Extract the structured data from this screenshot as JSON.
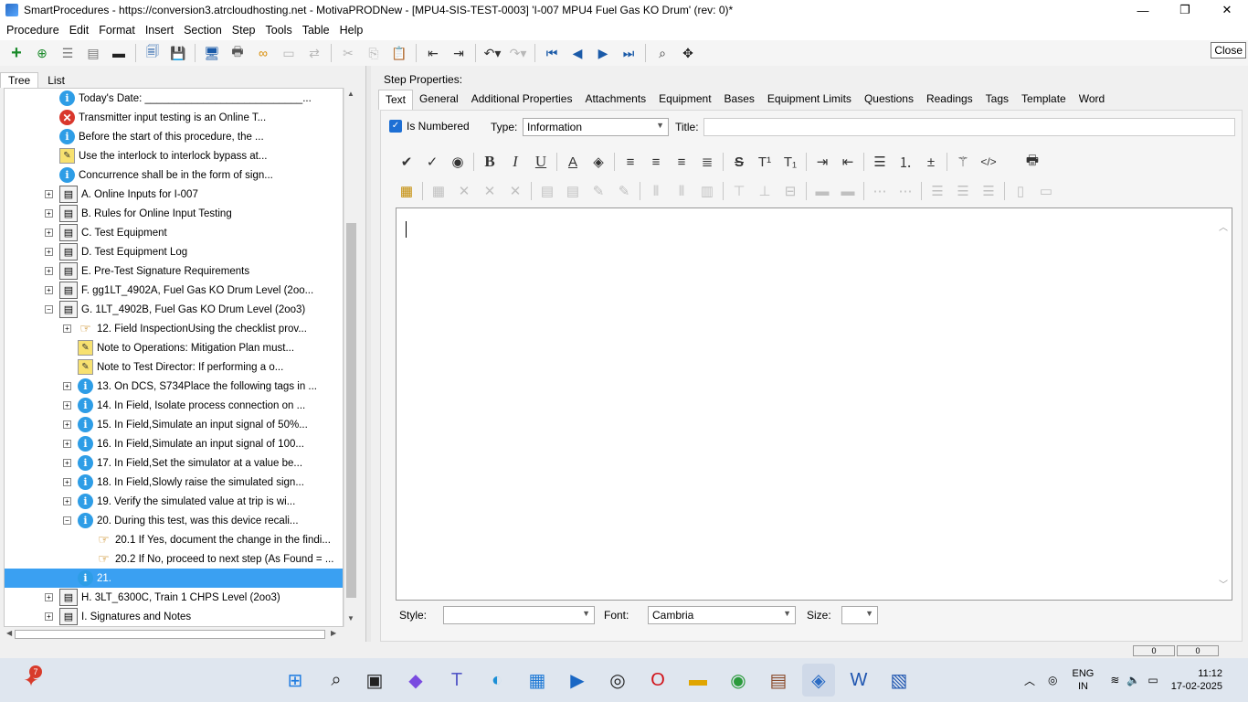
{
  "window": {
    "title": "SmartProcedures - https://conversion3.atrcloudhosting.net - MotivaPRODNew - [MPU4-SIS-TEST-0003] 'I-007 MPU4 Fuel Gas KO Drum' (rev: 0)*"
  },
  "menu": [
    "Procedure",
    "Edit",
    "Format",
    "Insert",
    "Section",
    "Step",
    "Tools",
    "Table",
    "Help"
  ],
  "tooltip": "Close",
  "left_tabs": [
    "Tree",
    "List"
  ],
  "tree": [
    {
      "icon": "info",
      "text": "Today's Date: ___________________________..."
    },
    {
      "icon": "err",
      "text": "Transmitter input testing is an Online T..."
    },
    {
      "icon": "info",
      "text": "Before the start of this procedure, the ..."
    },
    {
      "icon": "warn",
      "text": "Use the interlock to interlock bypass at..."
    },
    {
      "icon": "info",
      "text": "Concurrence shall be in the form of sign..."
    },
    {
      "icon": "doc",
      "exp": "+",
      "text": "A. Online Inputs for I-007"
    },
    {
      "icon": "doc",
      "exp": "+",
      "text": "B. Rules for Online Input Testing"
    },
    {
      "icon": "doc",
      "exp": "+",
      "text": "C. Test Equipment"
    },
    {
      "icon": "doc",
      "exp": "+",
      "text": "D. Test Equipment Log"
    },
    {
      "icon": "doc",
      "exp": "+",
      "text": "E. Pre-Test Signature Requirements"
    },
    {
      "icon": "doc",
      "exp": "+",
      "text": "F. gg1LT_4902A, Fuel Gas KO Drum Level (2oo..."
    },
    {
      "icon": "doc",
      "exp": "−",
      "text": "G. 1LT_4902B, Fuel Gas KO Drum Level (2oo3)"
    },
    {
      "icon": "hand",
      "exp": "+",
      "text": "12. Field InspectionUsing the checklist prov..."
    },
    {
      "icon": "warn",
      "text": "Note to Operations: Mitigation Plan must..."
    },
    {
      "icon": "warn",
      "text": "Note to Test Director: If performing a o..."
    },
    {
      "icon": "info",
      "exp": "+",
      "text": "13. On DCS, S734Place the following tags in ..."
    },
    {
      "icon": "info",
      "exp": "+",
      "text": "14. In Field, Isolate process connection on ..."
    },
    {
      "icon": "info",
      "exp": "+",
      "text": "15. In Field,Simulate an input signal of 50%..."
    },
    {
      "icon": "info",
      "exp": "+",
      "text": "16. In Field,Simulate an input signal of 100..."
    },
    {
      "icon": "info",
      "exp": "+",
      "text": "17. In Field,Set the simulator at a value be..."
    },
    {
      "icon": "info",
      "exp": "+",
      "text": "18. In Field,Slowly raise the simulated sign..."
    },
    {
      "icon": "info",
      "exp": "+",
      "text": "19. Verify the simulated value at trip is wi..."
    },
    {
      "icon": "info",
      "exp": "−",
      "text": "20. During this test, was this device recali..."
    },
    {
      "icon": "hand",
      "text": "20.1 If Yes, document the change in the findi..."
    },
    {
      "icon": "hand",
      "text": "20.2 If No, proceed to next step (As Found = ..."
    },
    {
      "icon": "info",
      "text": "21.",
      "selected": true
    },
    {
      "icon": "doc",
      "exp": "+",
      "text": "H. 3LT_6300C, Train 1 CHPS Level (2oo3)"
    },
    {
      "icon": "doc",
      "exp": "+",
      "text": "I. Signatures and Notes"
    }
  ],
  "step_properties": {
    "label": "Step Properties:",
    "tabs": [
      "Text",
      "General",
      "Additional Properties",
      "Attachments",
      "Equipment",
      "Bases",
      "Equipment Limits",
      "Questions",
      "Readings",
      "Tags",
      "Template",
      "Word"
    ],
    "is_numbered_label": "Is Numbered",
    "type_label": "Type:",
    "type_value": "Information",
    "title_label": "Title:",
    "title_value": ""
  },
  "bottom": {
    "style_label": "Style:",
    "style_value": "",
    "font_label": "Font:",
    "font_value": "Cambria",
    "size_label": "Size:",
    "size_value": ""
  },
  "status": [
    "0",
    "0"
  ],
  "taskbar": {
    "badge": "7",
    "lang": "ENG",
    "region": "IN",
    "time": "11:12",
    "date": "17-02-2025"
  }
}
